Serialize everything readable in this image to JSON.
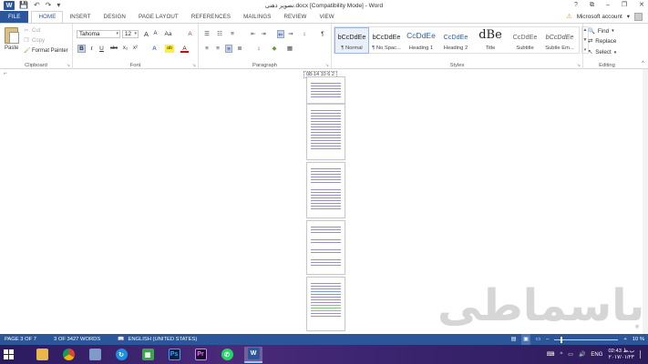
{
  "window": {
    "title": "تصویر ذهنی.docx [Compatibility Mode] - Word",
    "help": "?",
    "controls": [
      "⧉",
      "–",
      "❐",
      "✕"
    ]
  },
  "qat": {
    "undo": "↶",
    "redo": "↷",
    "customize": "▾"
  },
  "tabs": [
    "FILE",
    "HOME",
    "INSERT",
    "DESIGN",
    "PAGE LAYOUT",
    "REFERENCES",
    "MAILINGS",
    "REVIEW",
    "VIEW"
  ],
  "active_tab": "HOME",
  "account": {
    "warning": "⚠",
    "label": "Microsoft account",
    "arrow": "▾"
  },
  "clipboard": {
    "paste": "Paste",
    "cut": "Cut",
    "copy": "Copy",
    "format_painter": "Format Painter",
    "group": "Clipboard"
  },
  "font": {
    "family": "Tahoma",
    "size": "12",
    "grow": "A",
    "shrink": "A",
    "clear": "A",
    "bold": "B",
    "italic": "I",
    "underline": "U",
    "strike": "abc",
    "subscript": "x₂",
    "superscript": "x²",
    "effects": "A",
    "highlight": "ab",
    "color": "A",
    "group": "Font"
  },
  "paragraph": {
    "group": "Paragraph",
    "show_marks": "¶"
  },
  "styles": {
    "group": "Styles",
    "items": [
      {
        "preview": "bCcDdEe",
        "name": "¶ Normal"
      },
      {
        "preview": "bCcDdEe",
        "name": "¶ No Spac..."
      },
      {
        "preview": "CcDdEe",
        "name": "Heading 1"
      },
      {
        "preview": "CcDdEe",
        "name": "Heading 2"
      },
      {
        "preview": "dBe",
        "name": "Title"
      },
      {
        "preview": "CcDdEe",
        "name": "Subtitle"
      },
      {
        "preview": "bCcDdEe",
        "name": "Subtle Em..."
      }
    ]
  },
  "editing": {
    "find": "Find",
    "replace": "Replace",
    "select": "Select",
    "group": "Editing"
  },
  "document": {
    "zoom_pages_label": "08-14  10  6  2",
    "ruler_corner": "⌐"
  },
  "watermark": "باسماطی",
  "status": {
    "page": "PAGE 3 OF 7",
    "words": "3 OF 3427 WORDS",
    "language": "ENGLISH (UNITED STATES)",
    "zoom": "10 %",
    "zoom_level": 0.1
  },
  "taskbar": {
    "apps": [
      "file-explorer",
      "chrome",
      "network",
      "app-blue",
      "calculator",
      "photoshop",
      "premiere",
      "whatsapp",
      "word"
    ],
    "lang": "ENG",
    "time": "02:43 ب.ظ",
    "date": "۲۰۱۷/۰۱/۲۳"
  }
}
